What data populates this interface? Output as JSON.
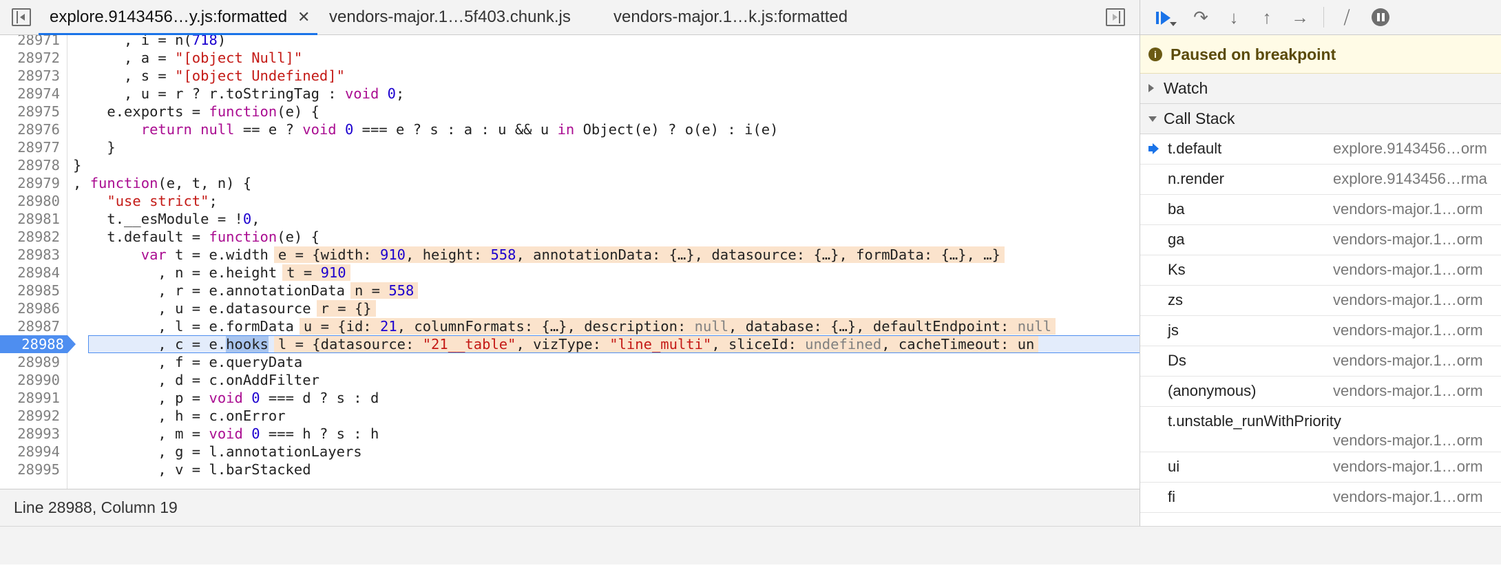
{
  "tabs": [
    {
      "label": "explore.9143456…y.js:formatted",
      "active": true,
      "closable": true
    },
    {
      "label": "vendors-major.1…5f403.chunk.js",
      "active": false
    },
    {
      "label": "vendors-major.1…k.js:formatted",
      "active": false
    }
  ],
  "editor": {
    "line_numbers": [
      "28971",
      "28972",
      "28973",
      "28974",
      "28975",
      "28976",
      "28977",
      "28978",
      "28979",
      "28980",
      "28981",
      "28982",
      "28983",
      "28984",
      "28985",
      "28986",
      "28987",
      "28988",
      "28989",
      "28990",
      "28991",
      "28992",
      "28993",
      "28994",
      "28995"
    ],
    "current_line": "28988",
    "lines": [
      "      , i = n(718)",
      "      , a = \"[object Null]\"",
      "      , s = \"[object Undefined]\"",
      "      , u = r ? r.toStringTag : void 0;",
      "    e.exports = function(e) {",
      "        return null == e ? void 0 === e ? s : a : u && u in Object(e) ? o(e) : i(e)",
      "    }",
      "}",
      ", function(e, t, n) {",
      "    \"use strict\";",
      "    t.__esModule = !0,",
      "    t.default = function(e) {",
      "        var t = e.width",
      "          , n = e.height",
      "          , r = e.annotationData",
      "          , u = e.datasource",
      "          , l = e.formData",
      "          , c = e.hooks",
      "          , f = e.queryData",
      "          , d = c.onAddFilter",
      "          , p = void 0 === d ? s : d",
      "          , h = c.onError",
      "          , m = void 0 === h ? s : h",
      "          , g = l.annotationLayers",
      "          , v = l.barStacked"
    ],
    "inline_values": {
      "l12": "e = {width: 910, height: 558, annotationData: {…}, datasource: {…}, formData: {…}, …}",
      "l13": "t = 910",
      "l14": "n = 558",
      "l15": "r = {}",
      "l16": "u = {id: 21, columnFormats: {…}, description: null, database: {…}, defaultEndpoint: null",
      "l17": "l = {datasource: \"21__table\", vizType: \"line_multi\", sliceId: undefined, cacheTimeout: un"
    },
    "selected_token": "hooks",
    "status": "Line 28988, Column 19"
  },
  "debugger": {
    "paused_message": "Paused on breakpoint",
    "watch_label": "Watch",
    "callstack_label": "Call Stack",
    "frames": [
      {
        "fn": "t.default",
        "loc": "explore.9143456…orm",
        "current": true
      },
      {
        "fn": "n.render",
        "loc": "explore.9143456…rma"
      },
      {
        "fn": "ba",
        "loc": "vendors-major.1…orm"
      },
      {
        "fn": "ga",
        "loc": "vendors-major.1…orm"
      },
      {
        "fn": "Ks",
        "loc": "vendors-major.1…orm"
      },
      {
        "fn": "zs",
        "loc": "vendors-major.1…orm"
      },
      {
        "fn": "js",
        "loc": "vendors-major.1…orm"
      },
      {
        "fn": "Ds",
        "loc": "vendors-major.1…orm"
      },
      {
        "fn": "(anonymous)",
        "loc": "vendors-major.1…orm"
      },
      {
        "fn": "t.unstable_runWithPriority",
        "loc": "vendors-major.1…orm"
      },
      {
        "fn": "ui",
        "loc": "vendors-major.1…orm"
      },
      {
        "fn": "fi",
        "loc": "vendors-major.1…orm"
      }
    ]
  },
  "colors": {
    "accent": "#1a73e8",
    "current_line": "#4e8ef0",
    "keyword": "#aa0d91",
    "string": "#c41a16",
    "number": "#1c00cf",
    "inline_value_bg": "#fbe3cc",
    "paused_banner_bg": "#fffbe6"
  }
}
